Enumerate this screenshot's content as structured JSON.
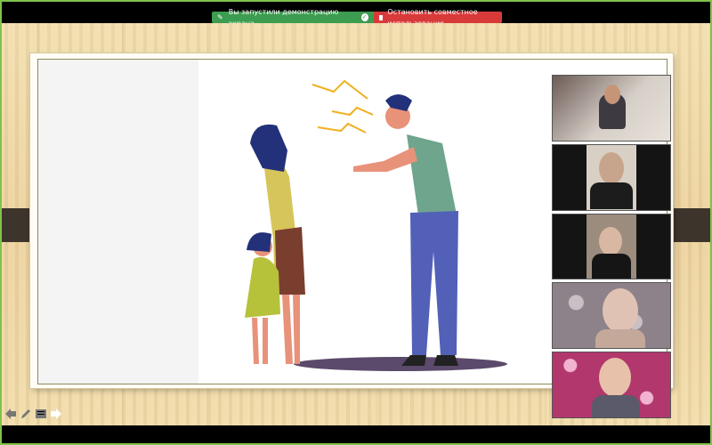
{
  "share_bar": {
    "status_label": "Вы запустили демонстрацию экрана",
    "stop_label": "Остановить совместное использование",
    "status_color": "#3c9c4f",
    "stop_color": "#d83a3a"
  },
  "participants": [
    {
      "name": ""
    },
    {
      "name": ""
    },
    {
      "name": ""
    },
    {
      "name": ""
    },
    {
      "name": ""
    }
  ],
  "toolbar": {
    "icons": [
      "back-arrow-icon",
      "pen-icon",
      "notes-icon",
      "forward-arrow-icon"
    ]
  }
}
